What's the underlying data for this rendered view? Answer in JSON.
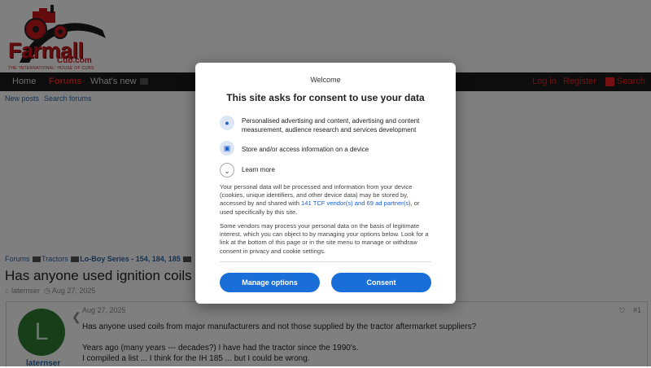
{
  "site": {
    "logo_text": "Farmall",
    "logo_sub": "Cub.com",
    "logo_tagline": "THE 'INTERNATIONAL' HOUSE OF CUBS"
  },
  "nav": {
    "home": "Home",
    "forums": "Forums",
    "whats_new": "What's new",
    "login": "Log in",
    "register": "Register",
    "search": "Search"
  },
  "subnav": {
    "new_posts": "New posts",
    "search_forums": "Search forums"
  },
  "breadcrumb": {
    "forums": "Forums",
    "tractors": "Tractors",
    "series": "Lo-Boy Series - 154, 184, 185"
  },
  "thread": {
    "title": "Has anyone used ignition coils from",
    "author": "laternser",
    "date": "Aug 27, 2025"
  },
  "post": {
    "avatar_letter": "L",
    "username": "laternser",
    "date": "Aug 27, 2025",
    "number": "#1",
    "lines": [
      "Has anyone used coils from major manufacturers and not those supplied by the tractor aftermarket suppliers?",
      "Years ago (many years --- decades?) I have had the tractor since the 1990's.",
      "I compiled a list ... I think for the IH 185 ... but I could be wrong."
    ]
  },
  "consent": {
    "welcome": "Welcome",
    "title": "This site asks for consent to use your data",
    "purpose_1": "Personalised advertising and content, advertising and content measurement, audience research and services development",
    "purpose_2": "Store and/or access information on a device",
    "learn_more": "Learn more",
    "para_1_a": "Your personal data will be processed and information from your device (cookies, unique identifiers, and other device data) may be stored by, accessed by and shared with ",
    "para_1_link": "141 TCF vendor(s) and 69 ad partner(s)",
    "para_1_b": ", or used specifically by this site.",
    "para_2": "Some vendors may process your personal data on the basis of legitimate interest, which you can object to by managing your options below. Look for a link at the bottom of this page or in the site menu to manage or withdraw consent in privacy and cookie settings.",
    "manage_options": "Manage options",
    "consent_button": "Consent"
  },
  "colors": {
    "brand_red": "#c8161d",
    "nav_bg": "#1a1a1a",
    "link_blue": "#2b64a8",
    "consent_blue": "#1a6ed8"
  },
  "icons": {
    "share": "share-icon",
    "chevron_left": "chevron-left-icon",
    "user": "user-icon",
    "clock": "clock-icon",
    "person": "person-icon",
    "device": "device-icon",
    "chevron_down": "chevron-down-icon"
  }
}
